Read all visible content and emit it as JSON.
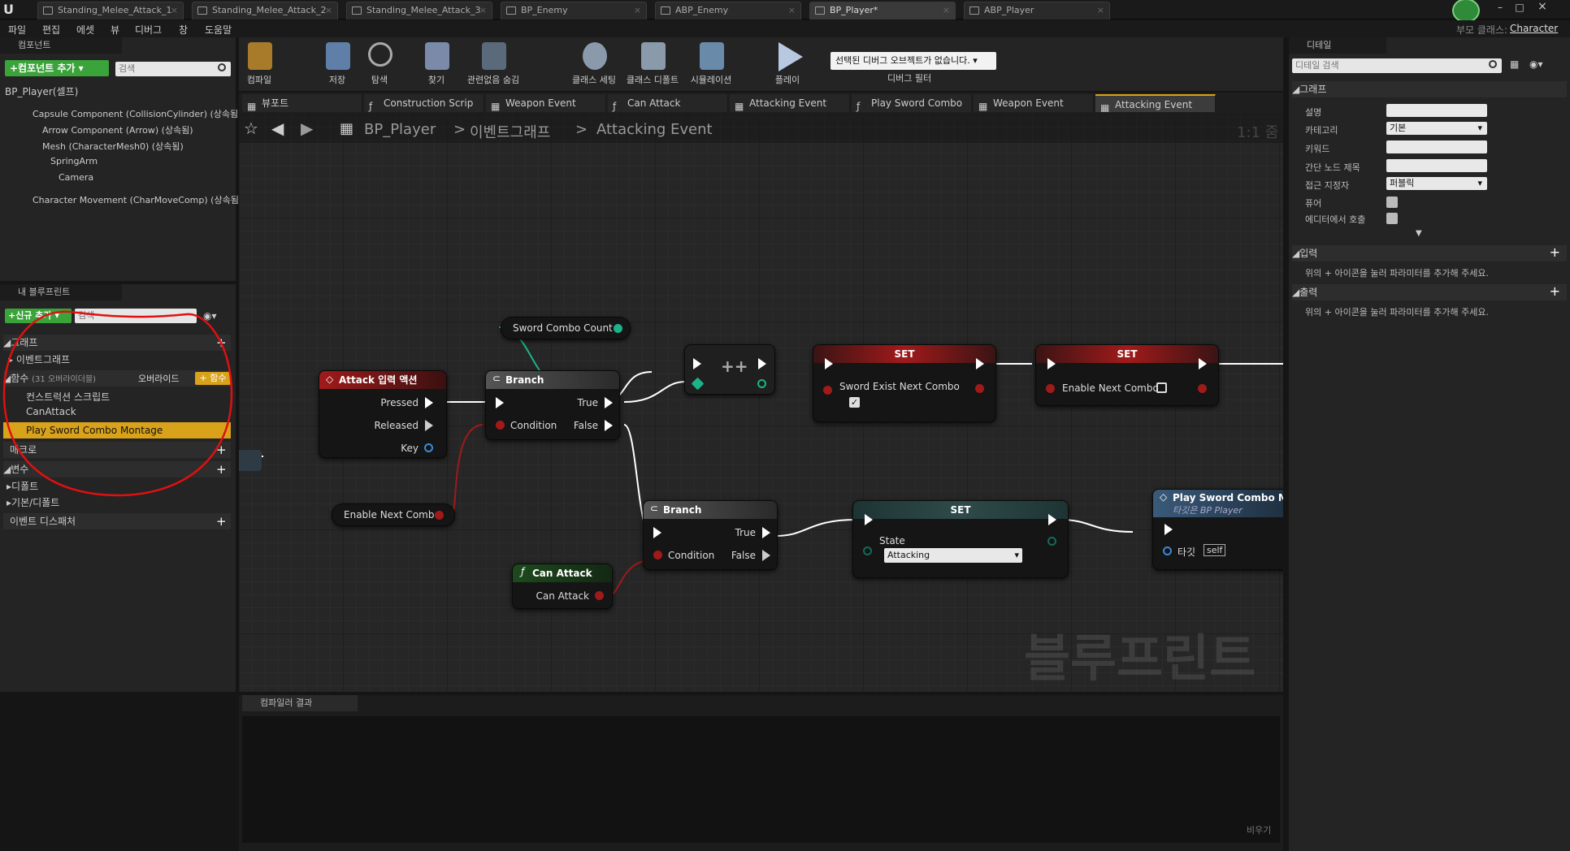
{
  "tabs": [
    "Standing_Melee_Attack_1",
    "Standing_Melee_Attack_2",
    "Standing_Melee_Attack_3",
    "BP_Enemy",
    "ABP_Enemy",
    "BP_Player*",
    "ABP_Player"
  ],
  "window": {
    "parent_class_label": "부모 클래스:",
    "parent_class": "Character"
  },
  "menu": [
    "파일",
    "편집",
    "에셋",
    "뷰",
    "디버그",
    "창",
    "도움말"
  ],
  "components": {
    "title": "컴포넌트",
    "add_button": "+컴포넌트 추가",
    "search_placeholder": "검색",
    "root": "BP_Player(셀프)",
    "items": [
      "Capsule Component (CollisionCylinder) (상속됨)",
      "Arrow Component (Arrow) (상속됨)",
      "Mesh (CharacterMesh0) (상속됨)",
      "SpringArm",
      "Camera",
      "Character Movement (CharMoveComp) (상속됨)"
    ]
  },
  "toolbar": [
    "컴파일",
    "저장",
    "탐색",
    "찾기",
    "관련없음 숨김",
    "클래스 세팅",
    "클래스 디폴트",
    "시뮬레이션",
    "플레이"
  ],
  "debug": {
    "selector": "선택된 디버그 오브젝트가 없습니다.",
    "label": "디버그 필터"
  },
  "my_blueprint": {
    "title": "내 블루프린트",
    "add_new": "+신규 추가",
    "search_placeholder": "검색",
    "graph_label": "그래프",
    "event_graph": "이벤트그래프",
    "functions_label": "함수",
    "functions_count": "(31 오버라이더블)",
    "override": "오버라이드",
    "add_function": "+ 함수",
    "functions": [
      "컨스트럭션 스크립트",
      "CanAttack",
      "Play Sword Combo Montage"
    ],
    "macros": "매크로",
    "variables": "변수",
    "default_cat": "디폴트",
    "base_default": "기본/디폴트",
    "dispatchers": "이벤트 디스패처"
  },
  "graph_tabs": [
    "뷰포트",
    "Construction Scrip",
    "Weapon Event",
    "Can Attack",
    "Attacking Event",
    "Play Sword Combo",
    "Weapon Event",
    "Attacking Event"
  ],
  "breadcrumb": {
    "bp": "BP_Player",
    "graph": "이벤트그래프",
    "event": "Attacking Event",
    "zoom": "1:1 줌"
  },
  "nodes": {
    "sword_combo_count": "Sword Combo Count",
    "attack_input": {
      "title": "Attack 입력 액션",
      "pressed": "Pressed",
      "released": "Released",
      "key": "Key"
    },
    "branch1": {
      "title": "Branch",
      "true": "True",
      "false": "False",
      "condition": "Condition"
    },
    "increment": "++",
    "set1": {
      "title": "SET",
      "var": "Sword Exist Next Combo"
    },
    "set2": {
      "title": "SET",
      "var": "Enable Next Combo"
    },
    "enable_next_combo": "Enable Next Combo",
    "branch2": {
      "title": "Branch",
      "true": "True",
      "false": "False",
      "condition": "Condition"
    },
    "can_attack": {
      "title": "Can Attack",
      "pin": "Can Attack"
    },
    "set3": {
      "title": "SET",
      "state": "State",
      "value": "Attacking"
    },
    "play_montage": {
      "title": "Play Sword Combo Mon",
      "subtitle": "타깃은 BP Player",
      "target": "타깃",
      "self": "self"
    }
  },
  "watermark": "블루프린트",
  "compiler": {
    "title": "컴파일러 결과",
    "clear": "비우기"
  },
  "details": {
    "title": "디테일",
    "search_placeholder": "디테일 검색",
    "graph_section": "그래프",
    "rows": [
      "설명",
      "카테고리",
      "키워드",
      "간단 노드 제목",
      "접근 지정자",
      "퓨어",
      "에디터에서 호출"
    ],
    "category_value": "기본",
    "access_value": "퍼블릭",
    "inputs": "입력",
    "outputs": "출력",
    "hint": "위의 + 아이콘을 눌러 파라미터를 추가해 주세요."
  },
  "colors": {
    "accent": "#d9a21b",
    "event_red": "#a11a1a",
    "set_teal": "#2f4a4a",
    "func_green": "#1d4a1d",
    "annotation_red": "#e01010"
  }
}
